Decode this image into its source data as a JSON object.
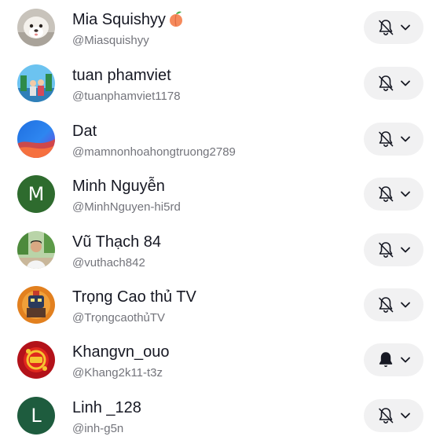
{
  "accounts": [
    {
      "name": "Mia Squishyy",
      "emoji": "peach-emoji",
      "handle": "@Miasquishyy",
      "avatar": "photo-avatar-icon",
      "notifications": "off"
    },
    {
      "name": "tuan phamviet",
      "handle": "@tuanphamviet1178",
      "avatar": "photo-avatar-icon",
      "notifications": "off"
    },
    {
      "name": "Dat",
      "handle": "@mamnonhoahongtruong2789",
      "avatar": "photo-avatar-icon",
      "notifications": "off"
    },
    {
      "name": "Minh Nguyễn",
      "handle": "@MinhNguyen-hi5rd",
      "avatar_letter": "M",
      "avatar_color": "#2e6b2e",
      "notifications": "off"
    },
    {
      "name": "Vũ Thạch 84",
      "handle": "@vuthach842",
      "avatar": "photo-avatar-icon",
      "notifications": "off"
    },
    {
      "name": "Trọng Cao thủ TV",
      "handle": "@TrọngcaothủTV",
      "avatar": "photo-avatar-icon",
      "notifications": "off"
    },
    {
      "name": "Khangvn_ouo",
      "handle": "@Khang2k11-t3z",
      "avatar": "photo-avatar-icon",
      "notifications": "on"
    },
    {
      "name": "Linh _128",
      "handle": "@inh-g5n",
      "avatar_letter": "L",
      "avatar_color": "#1e5c3e",
      "notifications": "off"
    }
  ],
  "icons": {
    "bell_off": "bell-off-icon",
    "bell_on": "bell-icon",
    "dropdown": "chevron-down-icon"
  }
}
